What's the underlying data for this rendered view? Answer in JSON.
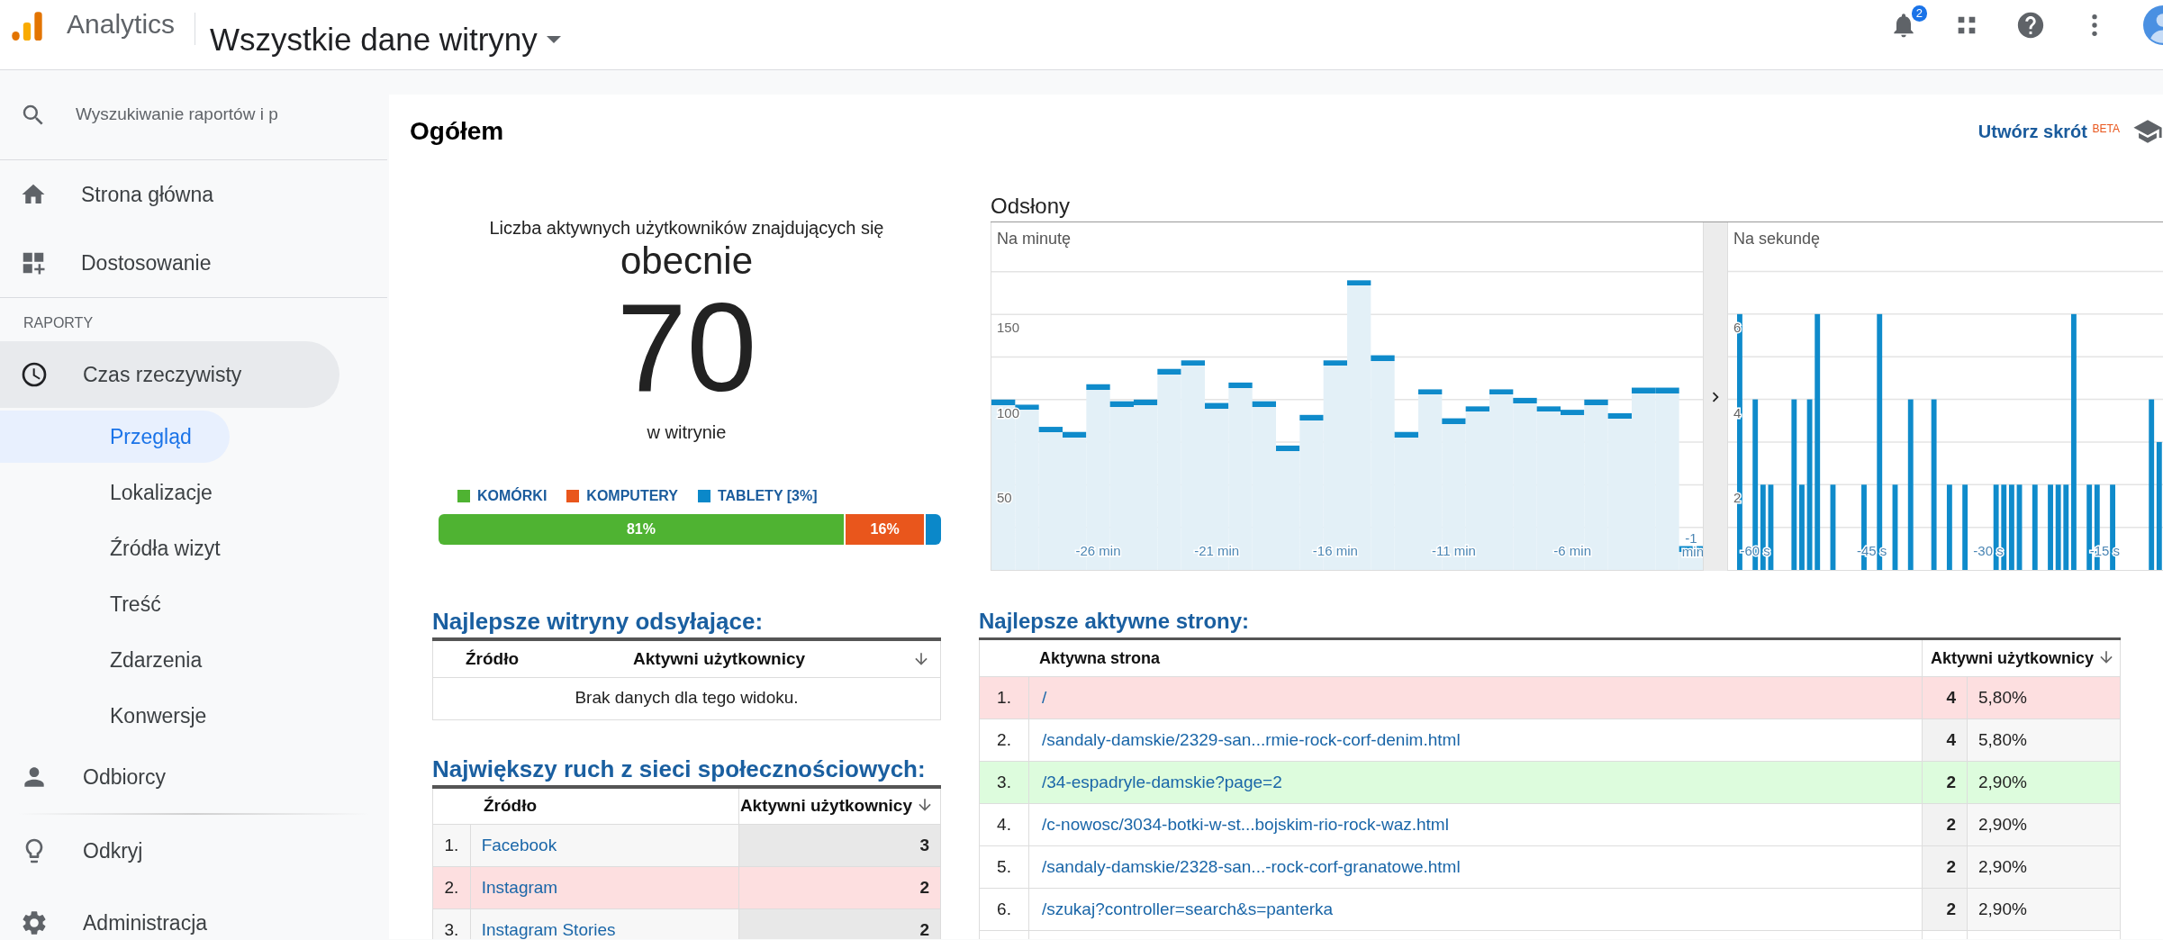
{
  "header": {
    "app_name": "Analytics",
    "property": "Wszystkie dane witryny",
    "notifications": "2"
  },
  "sidebar": {
    "search_placeholder": "Wyszukiwanie raportów i p",
    "nav_top": [
      {
        "label": "Strona główna",
        "selected": false
      },
      {
        "label": "Dostosowanie",
        "selected": false
      }
    ],
    "section_label": "RAPORTY",
    "reports": [
      {
        "label": "Czas rzeczywisty",
        "expanded": true,
        "children": [
          {
            "label": "Przegląd",
            "selected": true
          },
          {
            "label": "Lokalizacje",
            "selected": false
          },
          {
            "label": "Źródła wizyt",
            "selected": false
          },
          {
            "label": "Treść",
            "selected": false
          },
          {
            "label": "Zdarzenia",
            "selected": false
          },
          {
            "label": "Konwersje",
            "selected": false
          }
        ]
      },
      {
        "label": "Odbiorcy",
        "expanded": false
      }
    ],
    "nav_bottom": [
      {
        "label": "Odkryj",
        "selected": false
      },
      {
        "label": "Administracja",
        "selected": false
      }
    ]
  },
  "main": {
    "title": "Ogółem",
    "shortcut": {
      "label": "Utwórz skrót",
      "badge": "BETA"
    }
  },
  "active_users": {
    "caption": "Liczba aktywnych użytkowników znajdujących się",
    "emphasis": "obecnie",
    "count": "70",
    "suffix": "w witrynie",
    "devices": [
      {
        "label": "KOMÓRKI",
        "color": "#4fb332",
        "reading": "81%"
      },
      {
        "label": "KOMPUTERY",
        "color": "#e9561c",
        "reading": "16%"
      },
      {
        "label": "TABLETY [3%]",
        "color": "#0b88c9"
      }
    ]
  },
  "pageviews": {
    "title": "Odsłony",
    "per_minute": {
      "chart_data": {
        "type": "bar",
        "title": "Na minutę",
        "x": [
          -30,
          -29,
          -28,
          -27,
          -26,
          -25,
          -24,
          -23,
          -22,
          -21,
          -20,
          -19,
          -18,
          -17,
          -16,
          -15,
          -14,
          -13,
          -12,
          -11,
          -10,
          -9,
          -8,
          -7,
          -6,
          -5,
          -4,
          -3,
          -2,
          -1
        ],
        "values": [
          100,
          97,
          84,
          81,
          109,
          99,
          100,
          118,
          123,
          98,
          110,
          99,
          73,
          91,
          123,
          170,
          126,
          81,
          106,
          89,
          96,
          106,
          101,
          96,
          94,
          100,
          92,
          107,
          107,
          14
        ],
        "xlim": [
          -30.5,
          -0.5
        ],
        "ylim": [
          0,
          204
        ],
        "grid": true,
        "yticks": [
          50,
          100,
          150
        ],
        "xticks": [
          {
            "value": -26,
            "label": "-26 min"
          },
          {
            "value": -21,
            "label": "-21 min"
          },
          {
            "value": -16,
            "label": "-16 min"
          },
          {
            "value": -11,
            "label": "-11 min"
          },
          {
            "value": -6,
            "label": "-6 min"
          },
          {
            "value": -1,
            "label": "-1 min"
          }
        ]
      }
    },
    "per_second": {
      "chart_data": {
        "type": "bar",
        "title": "Na sekundę",
        "x": [
          -62,
          -60,
          -59,
          -58,
          -55,
          -54,
          -53,
          -52,
          -50,
          -46,
          -44,
          -42,
          -40,
          -37,
          -35,
          -33,
          -29,
          -28,
          -27,
          -26,
          -24,
          -22,
          -21,
          -20,
          -19,
          -17,
          -16,
          -14,
          -9,
          -8
        ],
        "values": [
          6,
          4,
          2,
          2,
          4,
          2,
          4,
          6,
          2,
          2,
          6,
          2,
          4,
          4,
          2,
          2,
          2,
          2,
          2,
          2,
          2,
          2,
          2,
          2,
          6,
          2,
          2,
          2,
          4,
          3
        ],
        "xlim": [
          -63.5,
          -7.4
        ],
        "ylim": [
          0,
          8.15
        ],
        "grid": true,
        "yticks": [
          2,
          4,
          6
        ],
        "xticks": [
          {
            "value": -60,
            "label": "-60 s"
          },
          {
            "value": -45,
            "label": "-45 s"
          },
          {
            "value": -30,
            "label": "-30 s"
          },
          {
            "value": -15,
            "label": "-15 s"
          }
        ]
      }
    }
  },
  "referrers": {
    "title": "Najlepsze witryny odsyłające:",
    "columns": [
      "Źródło",
      "Aktywni użytkownicy"
    ],
    "empty_text": "Brak danych dla tego widoku."
  },
  "social": {
    "title": "Największy ruch z sieci społecznościowych:",
    "columns": [
      "Źródło",
      "Aktywni użytkownicy"
    ],
    "rows": [
      {
        "index": "1.",
        "source": "Facebook",
        "users": "3",
        "increase": false,
        "decrease": false
      },
      {
        "index": "2.",
        "source": "Instagram",
        "users": "2",
        "increase": false,
        "decrease": true
      },
      {
        "index": "3.",
        "source": "Instagram Stories",
        "users": "2",
        "increase": false,
        "decrease": false
      }
    ]
  },
  "active_pages": {
    "title": "Najlepsze aktywne strony:",
    "columns": [
      "Aktywna strona",
      "Aktywni użytkownicy"
    ],
    "rows": [
      {
        "index": "1.",
        "page": "/",
        "users": "4",
        "share": "5,80%",
        "increase": false,
        "decrease": true
      },
      {
        "index": "2.",
        "page": "/sandaly-damskie/2329-san...rmie-rock-corf-denim.html",
        "users": "4",
        "share": "5,80%",
        "increase": false,
        "decrease": false
      },
      {
        "index": "3.",
        "page": "/34-espadryle-damskie?page=2",
        "users": "2",
        "share": "2,90%",
        "increase": true,
        "decrease": false
      },
      {
        "index": "4.",
        "page": "/c-nowosc/3034-botki-w-st...bojskim-rio-rock-waz.html",
        "users": "2",
        "share": "2,90%",
        "increase": false,
        "decrease": false
      },
      {
        "index": "5.",
        "page": "/sandaly-damskie/2328-san...-rock-corf-granatowe.html",
        "users": "2",
        "share": "2,90%",
        "increase": false,
        "decrease": false
      },
      {
        "index": "6.",
        "page": "/szukaj?controller=search&s=panterka",
        "users": "2",
        "share": "2,90%",
        "increase": false,
        "decrease": false
      }
    ]
  }
}
